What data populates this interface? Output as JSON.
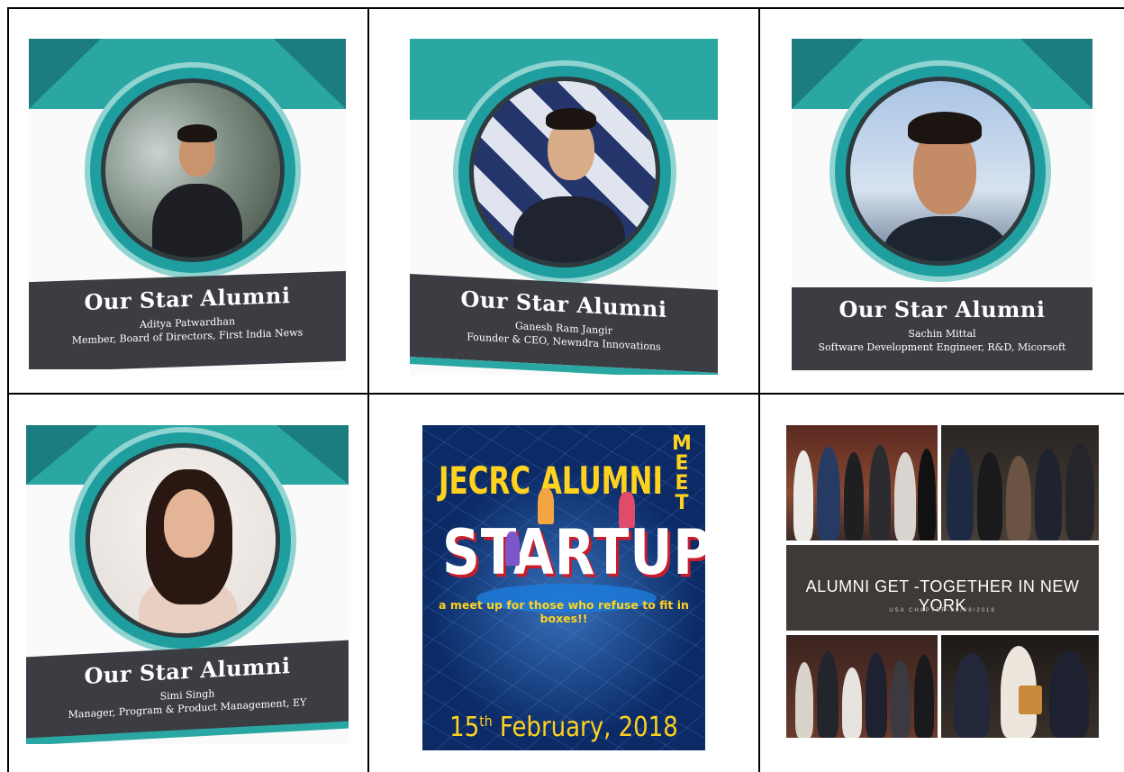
{
  "cards": [
    {
      "title": "Our Star Alumni",
      "name": "Aditya Patwardhan",
      "role": "Member, Board of Directors, First India News"
    },
    {
      "title": "Our Star Alumni",
      "name": "Ganesh Ram Jangir",
      "role": "Founder & CEO, Newndra Innovations"
    },
    {
      "title": "Our Star Alumni",
      "name": "Sachin Mittal",
      "role": "Software Development Engineer, R&D, Micorsoft"
    },
    {
      "title": "Our Star Alumni",
      "name": "Simi Singh",
      "role": "Manager, Program & Product Management, EY"
    }
  ],
  "poster": {
    "headline": "JECRC ALUMNI",
    "meet_letters": [
      "M",
      "E",
      "E",
      "T"
    ],
    "startup": "STARTUP",
    "tagline": "a meet up for those who refuse to fit in boxes!!",
    "date_day": "15",
    "date_suffix": "th",
    "date_rest": " February, 2018"
  },
  "collage": {
    "title": "ALUMNI GET -TOGETHER IN NEW YORK",
    "subtitle": "USA CHAPTER-09/08/2018"
  },
  "colors": {
    "teal": "#2aa7a3",
    "caption_bg": "#3b3d42",
    "poster_bg": "#0b2a66",
    "poster_yellow": "#ffd21f",
    "banner_bg": "#3e3a38"
  }
}
